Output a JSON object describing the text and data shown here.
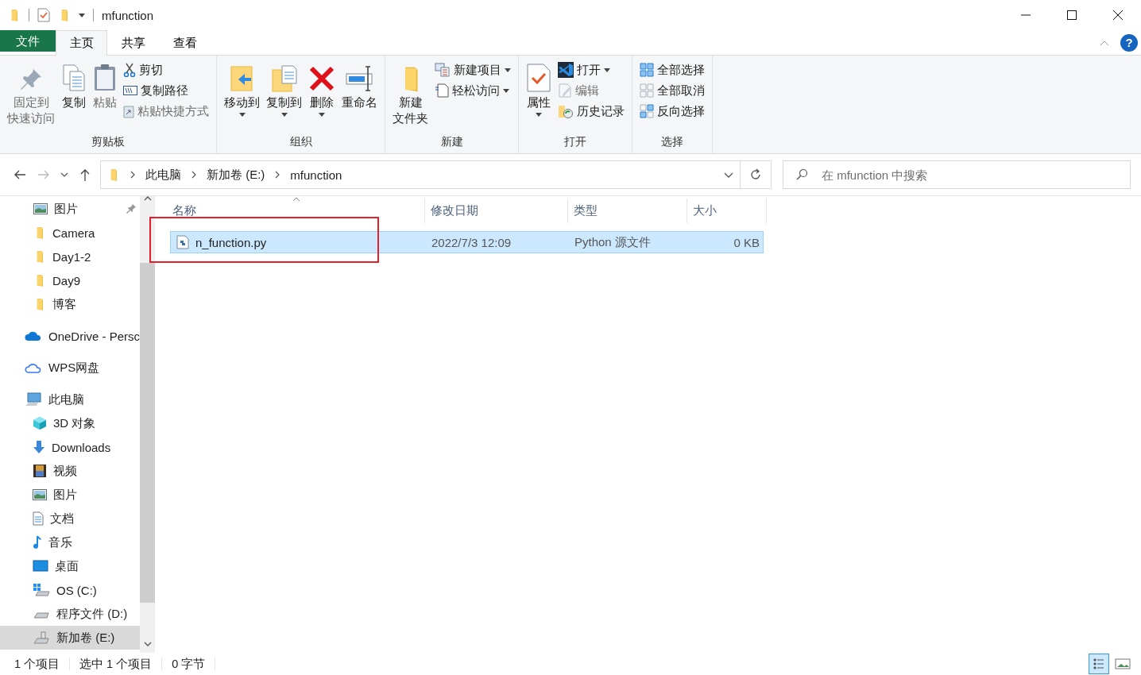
{
  "window": {
    "title": "mfunction",
    "help": "?"
  },
  "ribbon_tabs": [
    {
      "label": "文件",
      "kind": "file",
      "selected": false
    },
    {
      "label": "主页",
      "kind": "tab",
      "selected": true
    },
    {
      "label": "共享",
      "kind": "tab",
      "selected": false
    },
    {
      "label": "查看",
      "kind": "tab",
      "selected": false
    }
  ],
  "ribbon_groups": [
    {
      "label": "剪贴板",
      "items": [
        {
          "kind": "large",
          "label": [
            "固定到",
            "快速访问"
          ],
          "disabled": true,
          "dropdown": false
        },
        {
          "kind": "large",
          "label": "复制",
          "disabled": false,
          "dropdown": false
        },
        {
          "kind": "large",
          "label": "粘贴",
          "disabled": true,
          "dropdown": false
        },
        {
          "kind": "small",
          "label": "剪切",
          "disabled": false,
          "dropdown": false
        },
        {
          "kind": "small",
          "label": "复制路径",
          "disabled": false,
          "dropdown": false
        },
        {
          "kind": "small",
          "label": "粘贴快捷方式",
          "disabled": true,
          "dropdown": false
        }
      ]
    },
    {
      "label": "组织",
      "items": [
        {
          "kind": "large",
          "label": "移动到",
          "disabled": false,
          "dropdown": true
        },
        {
          "kind": "large",
          "label": "复制到",
          "disabled": false,
          "dropdown": true
        },
        {
          "kind": "large",
          "label": "删除",
          "disabled": false,
          "dropdown": true
        },
        {
          "kind": "large",
          "label": "重命名",
          "disabled": false,
          "dropdown": false
        }
      ]
    },
    {
      "label": "新建",
      "items": [
        {
          "kind": "large",
          "label": [
            "新建",
            "文件夹"
          ],
          "disabled": false,
          "dropdown": false
        },
        {
          "kind": "small",
          "label": "新建项目",
          "disabled": false,
          "dropdown": true
        },
        {
          "kind": "small",
          "label": "轻松访问",
          "disabled": false,
          "dropdown": true
        }
      ]
    },
    {
      "label": "打开",
      "items": [
        {
          "kind": "large",
          "label": "属性",
          "disabled": false,
          "dropdown": true
        },
        {
          "kind": "small",
          "label": "打开",
          "disabled": false,
          "dropdown": true
        },
        {
          "kind": "small",
          "label": "编辑",
          "disabled": true,
          "dropdown": false
        },
        {
          "kind": "small",
          "label": "历史记录",
          "disabled": false,
          "dropdown": false
        }
      ]
    },
    {
      "label": "选择",
      "items": [
        {
          "kind": "small",
          "label": "全部选择",
          "disabled": false,
          "dropdown": false
        },
        {
          "kind": "small",
          "label": "全部取消",
          "disabled": false,
          "dropdown": false
        },
        {
          "kind": "small",
          "label": "反向选择",
          "disabled": false,
          "dropdown": false
        }
      ]
    }
  ],
  "navigation_bar": {
    "forward_disabled": true,
    "breadcrumbs": [
      "此电脑",
      "新加卷 (E:)",
      "mfunction"
    ],
    "search": {
      "placeholder": "在 mfunction 中搜索"
    }
  },
  "sidebar": {
    "quick_access_items": [
      {
        "label": "图片",
        "pinned": true,
        "selected": false
      },
      {
        "label": "Camera",
        "pinned": false,
        "selected": false
      },
      {
        "label": "Day1-2",
        "pinned": false,
        "selected": false
      },
      {
        "label": "Day9",
        "pinned": false,
        "selected": false
      },
      {
        "label": "博客",
        "pinned": false,
        "selected": false
      }
    ],
    "locations": [
      {
        "label": "OneDrive - Persc",
        "selected": false
      },
      {
        "label": "WPS网盘",
        "selected": false
      },
      {
        "label": "此电脑",
        "selected": false,
        "children": [
          {
            "label": "3D 对象",
            "selected": false
          },
          {
            "label": "Downloads",
            "selected": false
          },
          {
            "label": "视频",
            "selected": false
          },
          {
            "label": "图片",
            "selected": false
          },
          {
            "label": "文档",
            "selected": false
          },
          {
            "label": "音乐",
            "selected": false
          },
          {
            "label": "桌面",
            "selected": false
          },
          {
            "label": "OS (C:)",
            "selected": false
          },
          {
            "label": "程序文件 (D:)",
            "selected": false
          },
          {
            "label": "新加卷 (E:)",
            "selected": true
          }
        ]
      }
    ]
  },
  "file_list": {
    "columns": [
      "名称",
      "修改日期",
      "类型",
      "大小"
    ],
    "rows": [
      {
        "name": "n_function.py",
        "modified": "2022/7/3 12:09",
        "type": "Python 源文件",
        "size": "0 KB",
        "selected": true,
        "highlighted": true
      }
    ]
  },
  "status_bar": {
    "items": [
      "1 个项目",
      "选中 1 个项目",
      "0 字节"
    ],
    "view_modes": [
      {
        "kind": "details",
        "selected": true
      },
      {
        "kind": "large-icons",
        "selected": false
      }
    ]
  }
}
